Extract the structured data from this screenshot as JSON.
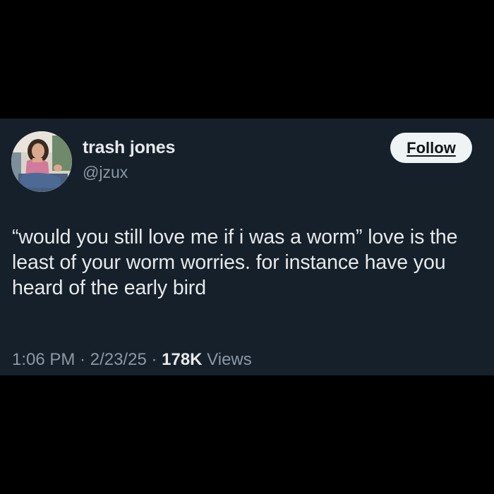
{
  "tweet": {
    "display_name": "trash jones",
    "handle": "@jzux",
    "follow_label": "Follow",
    "text": "“would you still love me if i was a worm” love is the least of your worm worries. for instance have you heard of the early bird",
    "time": "1:06 PM",
    "separator_1": " · ",
    "date": "2/23/25",
    "separator_2": " · ",
    "views_count": "178K",
    "views_label": " Views"
  },
  "colors": {
    "background": "#000000",
    "card": "#15202b",
    "primary_text": "#e7e9ea",
    "secondary_text": "#8b98a5",
    "follow_button_bg": "#eff3f4",
    "follow_button_text": "#0f1419"
  }
}
